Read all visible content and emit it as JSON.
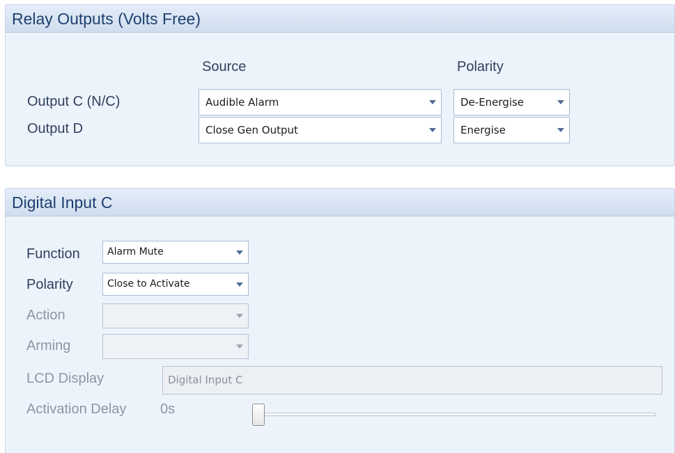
{
  "relay_outputs": {
    "title": "Relay Outputs (Volts Free)",
    "source_header": "Source",
    "polarity_header": "Polarity",
    "rows": [
      {
        "label": "Output C (N/C)",
        "source": "Audible Alarm",
        "polarity": "De-Energise"
      },
      {
        "label": "Output D",
        "source": "Close Gen Output",
        "polarity": "Energise"
      }
    ]
  },
  "digital_input": {
    "title": "Digital Input C",
    "function_label": "Function",
    "function_value": "Alarm Mute",
    "polarity_label": "Polarity",
    "polarity_value": "Close to Activate",
    "action_label": "Action",
    "action_value": "",
    "arming_label": "Arming",
    "arming_value": "",
    "lcd_label": "LCD Display",
    "lcd_value": "Digital Input C",
    "delay_label": "Activation Delay",
    "delay_value": "0s",
    "delay_fraction": 0.0
  }
}
